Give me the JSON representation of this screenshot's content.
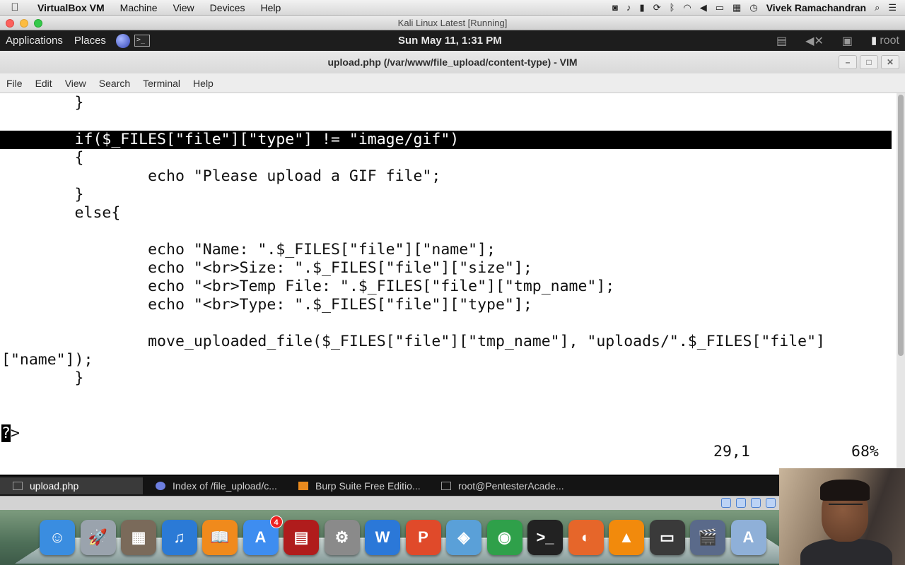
{
  "mac_menubar": {
    "app_name": "VirtualBox VM",
    "menus": [
      "Machine",
      "View",
      "Devices",
      "Help"
    ],
    "user": "Vivek Ramachandran",
    "status_icons": [
      "camera-icon",
      "bell-icon",
      "battery-icon",
      "sync-icon",
      "bluetooth-icon",
      "wifi-icon",
      "volume-icon",
      "display-icon",
      "grid-icon",
      "clock-icon",
      "search-icon",
      "list-icon"
    ]
  },
  "vbox_window": {
    "title": "Kali Linux Latest [Running]"
  },
  "kali_panel": {
    "applications": "Applications",
    "places": "Places",
    "clock": "Sun May 11,  1:31 PM",
    "user": "root"
  },
  "terminal_window": {
    "title": "upload.php (/var/www/file_upload/content-type) - VIM",
    "menu": [
      "File",
      "Edit",
      "View",
      "Search",
      "Terminal",
      "Help"
    ]
  },
  "editor": {
    "lines": [
      "        }",
      "",
      "        if($_FILES[\"file\"][\"type\"] != \"image/gif\")",
      "        {",
      "                echo \"Please upload a GIF file\";",
      "        }",
      "        else{",
      "",
      "                echo \"Name: \".$_FILES[\"file\"][\"name\"];",
      "                echo \"<br>Size: \".$_FILES[\"file\"][\"size\"];",
      "                echo \"<br>Temp File: \".$_FILES[\"file\"][\"tmp_name\"];",
      "                echo \"<br>Type: \".$_FILES[\"file\"][\"type\"];",
      "",
      "                move_uploaded_file($_FILES[\"file\"][\"tmp_name\"], \"uploads/\".$_FILES[\"file\"]",
      "[\"name\"]);",
      "        }",
      "",
      "",
      "?>"
    ],
    "cursor_char": "?",
    "after_cursor": ">",
    "position": "29,1",
    "percent": "68%"
  },
  "taskbar": {
    "items": [
      {
        "label": "upload.php",
        "icon": "terminal-icon"
      },
      {
        "label": "Index of /file_upload/c...",
        "icon": "firefox-icon"
      },
      {
        "label": "Burp Suite Free Editio...",
        "icon": "burp-icon"
      },
      {
        "label": "root@PentesterAcade...",
        "icon": "terminal-icon"
      }
    ]
  },
  "dock": {
    "apps": [
      {
        "name": "finder-icon",
        "glyph": "☺",
        "color": "#3a8de0"
      },
      {
        "name": "launchpad-icon",
        "glyph": "🚀",
        "color": "#9aa3ad"
      },
      {
        "name": "photos-icon",
        "glyph": "▦",
        "color": "#7a6a5a"
      },
      {
        "name": "itunes-icon",
        "glyph": "♫",
        "color": "#2b7ad6"
      },
      {
        "name": "ibooks-icon",
        "glyph": "📖",
        "color": "#f08a1c"
      },
      {
        "name": "appstore-icon",
        "glyph": "A",
        "color": "#3e8df0",
        "badge": "4"
      },
      {
        "name": "photobooth-icon",
        "glyph": "▤",
        "color": "#b01c1c"
      },
      {
        "name": "system-prefs-icon",
        "glyph": "⚙",
        "color": "#8a8a8a"
      },
      {
        "name": "word-icon",
        "glyph": "W",
        "color": "#2b78d8"
      },
      {
        "name": "powerpoint-icon",
        "glyph": "P",
        "color": "#e04a2a"
      },
      {
        "name": "maps-icon",
        "glyph": "◈",
        "color": "#5aa0d8"
      },
      {
        "name": "chrome-icon",
        "glyph": "◉",
        "color": "#2fa04a"
      },
      {
        "name": "terminal-icon",
        "glyph": ">_",
        "color": "#222222"
      },
      {
        "name": "firefox-icon",
        "glyph": "◐",
        "color": "#e6662a"
      },
      {
        "name": "vlc-icon",
        "glyph": "▲",
        "color": "#f28a0c"
      },
      {
        "name": "virtualbox-screen-icon",
        "glyph": "▭",
        "color": "#3a3a3a"
      },
      {
        "name": "video-icon",
        "glyph": "🎬",
        "color": "#5a6a8a"
      },
      {
        "name": "applications-folder-icon",
        "glyph": "A",
        "color": "#8fb0d8"
      }
    ]
  }
}
